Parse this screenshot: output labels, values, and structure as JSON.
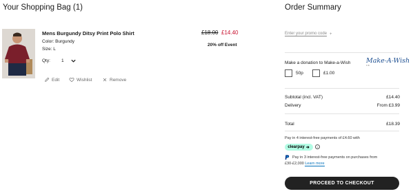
{
  "bag": {
    "title": "Your Shopping Bag (1)",
    "item": {
      "name": "Mens Burgundy Ditsy Print Polo Shirt",
      "color": "Color: Burgundy",
      "size": "Size: L",
      "qty_label": "Qty:",
      "qty_value": "1",
      "price_old": "£18.00",
      "price_new": "£14.40",
      "promo": "20% off Event",
      "actions": {
        "edit": "Edit",
        "wishlist": "Wishlist",
        "remove": "Remove"
      }
    }
  },
  "summary": {
    "title": "Order Summary",
    "promo_link": "Enter your promo code",
    "promo_plus": "+",
    "donation": {
      "label": "Make a donation to Make-a-Wish",
      "logo_text": "Make-A-Wish",
      "logo_sub": "UK",
      "options": [
        "50p",
        "£1.00"
      ]
    },
    "subtotal_label": "Subtotal (incl. VAT)",
    "subtotal_value": "£14.40",
    "delivery_label": "Delivery",
    "delivery_value": "From £3.99",
    "total_label": "Total",
    "total_value": "£18.39",
    "clearpay_text": "Pay in 4 interest-free payments of £4.60 with",
    "clearpay_badge": "clearpay",
    "paypal_text1": "Pay in 3 interest-free payments on purchases from",
    "paypal_text2": "£30-£2,000",
    "paypal_learn": "Learn more",
    "checkout_label": "PROCEED TO CHECKOUT"
  },
  "colors": {
    "sale_red": "#c8102e",
    "checkout_bg": "#222222",
    "clearpay_mint": "#b2fce4",
    "paypal_blue": "#0070ba",
    "charity_blue": "#1d4f91"
  }
}
